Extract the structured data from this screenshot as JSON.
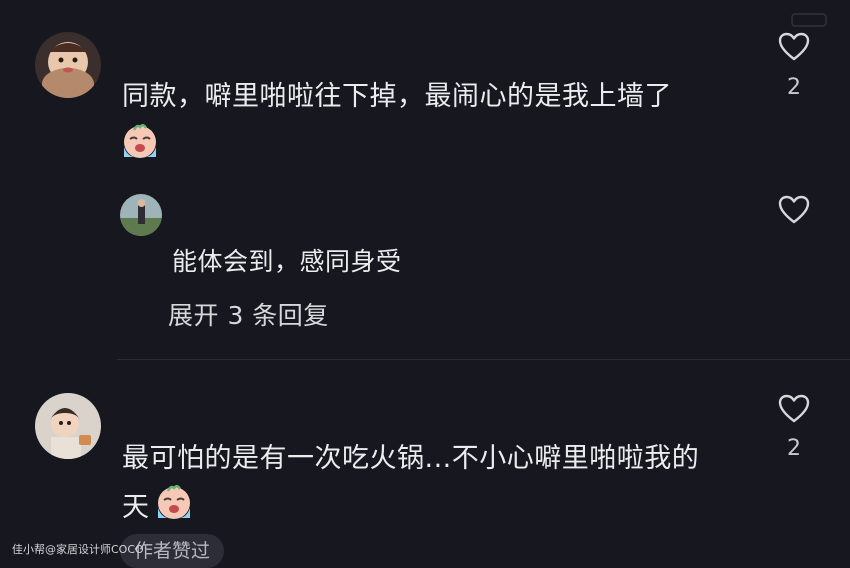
{
  "comments": [
    {
      "text": "同款，噼里啪啦往下掉，最闹心的是我上墙了",
      "emoji": "crying-face-emoji",
      "likes": "2",
      "reply": {
        "text": "能体会到，感同身受",
        "expand_label": "展开 3 条回复"
      }
    },
    {
      "text_line1": "最可怕的是有一次吃火锅...不小心噼里啪啦我的",
      "text_line2": "天",
      "emoji": "crying-face-emoji",
      "likes": "2",
      "badge": "作者赞过"
    }
  ],
  "watermark": "佳小帮@家居设计师COCO",
  "colors": {
    "background": "#16171f",
    "text": "#ececef",
    "muted": "#c9c9cd",
    "badge_bg": "#2c2d36"
  }
}
